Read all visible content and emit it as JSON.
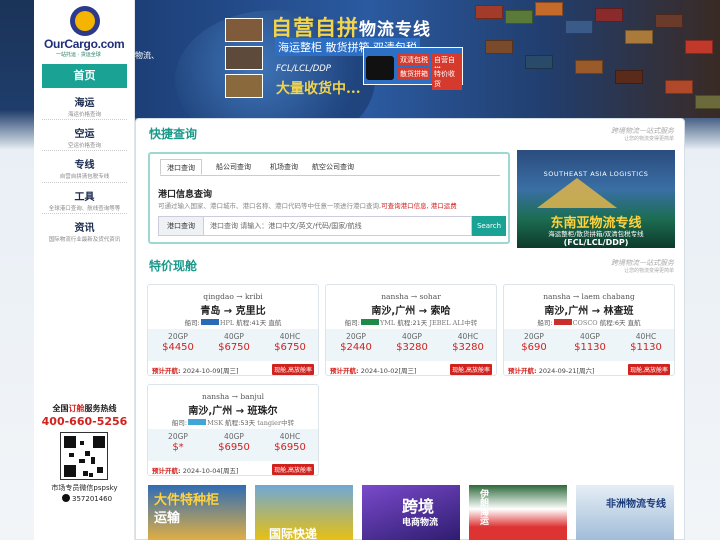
{
  "brand": {
    "logo_text": "OurCargo.com",
    "logo_sub": "一站托运 · 货运全球"
  },
  "hero": {
    "title_part1": "自营自拼",
    "title_part2": "物流专线",
    "subtitle": "海运整柜 散货拼箱 双清包税",
    "fcl": "FCL/LCL/DDP",
    "big": "大量收货中...",
    "left_text": "物流、",
    "badge1": "双清包税",
    "badge2": "自营自拼",
    "badge3": "散货拼箱",
    "badge4": "特价收货"
  },
  "nav": {
    "home": "首页",
    "items": [
      {
        "title": "海运",
        "sub": "海运价格查询"
      },
      {
        "title": "空运",
        "sub": "空运价格查询"
      },
      {
        "title": "专线",
        "sub": "自营自拼清包税专线"
      },
      {
        "title": "工具",
        "sub": "全球港口查询、航线查询等等"
      },
      {
        "title": "资讯",
        "sub": "国际物流行业最新及货代资讯"
      }
    ]
  },
  "hotline": {
    "label_pre": "全国",
    "label_em": "订舱",
    "label_post": "服务热线",
    "number": "400-660-5256",
    "wechat": "市场专员微信pspsky",
    "qq": "357201460"
  },
  "quick": {
    "title": "快捷查询",
    "slogan": "跨境物流一站式服务",
    "slogan_sub": "让您的物流变得更简单",
    "tabs": [
      "港口查询",
      "船公司查询",
      "机场查询",
      "航空公司查询"
    ],
    "heading": "港口信息查询",
    "desc": "可通过输入国家、港口城市、港口名称、港口代码等中任意一项进行港口查询,",
    "desc_em": "可查询港口信息, 港口运费",
    "select": "港口查询",
    "placeholder": "港口查询 请输入：港口中文/英文/代码/国家/航线",
    "button": "Search"
  },
  "promo": {
    "en": "SOUTHEAST ASIA LOGISTICS",
    "cn": "东南亚物流专线",
    "sub": "海运整柜/散货拼箱/双清包税专线",
    "fcl": "(FCL/LCL/DDP)"
  },
  "special": {
    "title": "特价现舱",
    "slogan": "跨境物流一站式服务",
    "slogan_sub": "让您的物流变得更简单",
    "labels": {
      "carrier": "船司:",
      "transit": "航程:",
      "etd": "预计开航:"
    },
    "cards": [
      {
        "route_en": "qingdao → kribi",
        "route_cn": "青岛 → 克里比",
        "carrier": "HPL",
        "transit": "41天",
        "via": "直航",
        "p20": "$4450",
        "p40": "$6750",
        "p40hc": "$6750",
        "etd": "2024-10-09[周三]",
        "tag": "现舱,高放舱率"
      },
      {
        "route_en": "nansha → sohar",
        "route_cn": "南沙,广州 → 索哈",
        "carrier": "YML",
        "transit": "21天",
        "via": "JEBEL ALI中转",
        "p20": "$2440",
        "p40": "$3280",
        "p40hc": "$3280",
        "etd": "2024-10-02[周三]",
        "tag": "现舱,高放舱率"
      },
      {
        "route_en": "nansha → laem chabang",
        "route_cn": "南沙,广州 → 林查班",
        "carrier": "COSCO",
        "transit": "6天",
        "via": "直航",
        "p20": "$690",
        "p40": "$1130",
        "p40hc": "$1130",
        "etd": "2024-09-21[周六]",
        "tag": "现舱,高放舱率"
      },
      {
        "route_en": "nansha → banjul",
        "route_cn": "南沙,广州 → 班珠尔",
        "carrier": "MSK",
        "transit": "53天",
        "via": "tangier中转",
        "p20": "$*",
        "p40": "$6950",
        "p40hc": "$6950",
        "etd": "2024-10-04[周五]",
        "tag": "现舱,高放舱率"
      }
    ],
    "container_types": [
      "20GP",
      "40GP",
      "40HC"
    ]
  },
  "thumbs": [
    {
      "text": "大件特种柜",
      "text2": "运输"
    },
    {
      "text": "国际快递",
      "text2": ""
    },
    {
      "text": "跨境",
      "text2": "电商物流"
    },
    {
      "text": "伊朗海运",
      "text2": ""
    },
    {
      "text": "非洲物流专线",
      "text2": ""
    }
  ],
  "colors": {
    "accent": "#1aa394",
    "price": "#d1221e",
    "nav": "#1a2a4e"
  }
}
